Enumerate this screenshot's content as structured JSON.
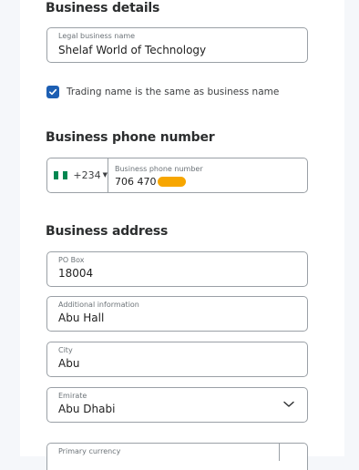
{
  "sections": {
    "business_details": "Business details",
    "business_phone": "Business phone number",
    "business_address": "Business address"
  },
  "legal_name": {
    "label": "Legal business name",
    "value": "Shelaf World of Technology"
  },
  "trading_checkbox": {
    "label": "Trading name is the same as business name",
    "checked": true
  },
  "phone": {
    "dial_code": "+234",
    "label": "Business phone number",
    "value": "706 470",
    "flag_colors": [
      "#008751",
      "#ffffff",
      "#008751"
    ],
    "redaction_color": "#f7a600"
  },
  "address": {
    "po_box": {
      "label": "PO Box",
      "value": "18004"
    },
    "additional": {
      "label": "Additional information",
      "value": "Abu Hall"
    },
    "city": {
      "label": "City",
      "value": "Abu"
    },
    "emirate": {
      "label": "Emirate",
      "value": "Abu Dhabi"
    }
  },
  "currency": {
    "label": "Primary currency"
  },
  "colors": {
    "accent": "#1d5fb3",
    "border": "#9aa0a6"
  },
  "icons": {
    "checkbox": "checkmark-icon",
    "country_caret": "caret-down-icon",
    "emirate_chevron": "chevron-down-icon"
  }
}
